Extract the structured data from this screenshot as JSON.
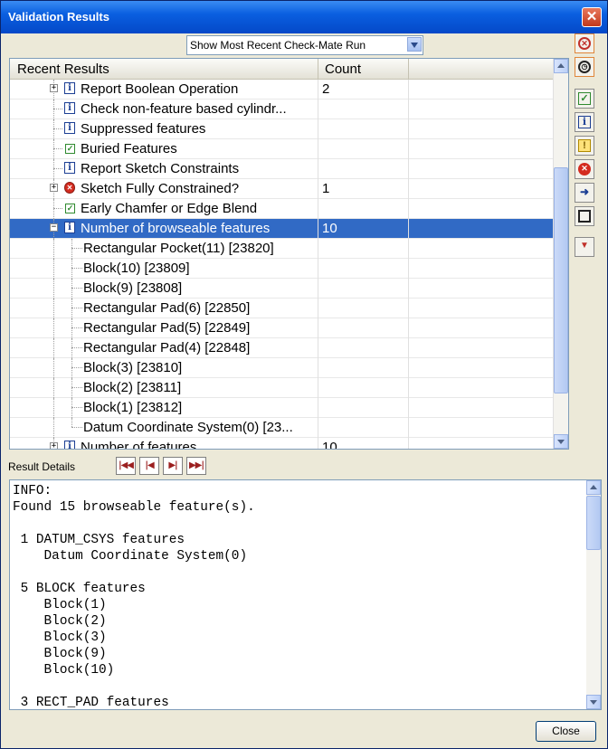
{
  "window": {
    "title": "Validation Results",
    "close_glyph": "✕"
  },
  "run_select": {
    "value": "Show Most Recent Check-Mate Run"
  },
  "results": {
    "headers": {
      "name": "Recent Results",
      "count": "Count"
    },
    "rows": [
      {
        "label": "Report Boolean Operation",
        "count": "2",
        "icon": "info-icon",
        "expander": "+",
        "indent": 1
      },
      {
        "label": "Check non-feature based cylindr...",
        "count": "",
        "icon": "info-icon",
        "expander": "",
        "indent": 1
      },
      {
        "label": "Suppressed features",
        "count": "",
        "icon": "info-icon",
        "expander": "",
        "indent": 1
      },
      {
        "label": "Buried Features",
        "count": "",
        "icon": "check-icon",
        "expander": "",
        "indent": 1
      },
      {
        "label": "Report Sketch Constraints",
        "count": "",
        "icon": "info-icon",
        "expander": "",
        "indent": 1
      },
      {
        "label": "Sketch Fully Constrained?",
        "count": "1",
        "icon": "error-icon",
        "expander": "+",
        "indent": 1
      },
      {
        "label": "Early Chamfer or Edge Blend",
        "count": "",
        "icon": "check-icon",
        "expander": "",
        "indent": 1
      },
      {
        "label": "Number of browseable features",
        "count": "10",
        "icon": "info-icon",
        "expander": "−",
        "indent": 1,
        "selected": true
      },
      {
        "label": "Rectangular Pocket(11) [23820]",
        "count": "",
        "icon": "",
        "expander": "",
        "indent": 2
      },
      {
        "label": "Block(10) [23809]",
        "count": "",
        "icon": "",
        "expander": "",
        "indent": 2
      },
      {
        "label": "Block(9) [23808]",
        "count": "",
        "icon": "",
        "expander": "",
        "indent": 2
      },
      {
        "label": "Rectangular Pad(6) [22850]",
        "count": "",
        "icon": "",
        "expander": "",
        "indent": 2
      },
      {
        "label": "Rectangular Pad(5) [22849]",
        "count": "",
        "icon": "",
        "expander": "",
        "indent": 2
      },
      {
        "label": "Rectangular Pad(4) [22848]",
        "count": "",
        "icon": "",
        "expander": "",
        "indent": 2
      },
      {
        "label": "Block(3) [23810]",
        "count": "",
        "icon": "",
        "expander": "",
        "indent": 2
      },
      {
        "label": "Block(2) [23811]",
        "count": "",
        "icon": "",
        "expander": "",
        "indent": 2
      },
      {
        "label": "Block(1) [23812]",
        "count": "",
        "icon": "",
        "expander": "",
        "indent": 2
      },
      {
        "label": "Datum Coordinate System(0) [23...",
        "count": "",
        "icon": "",
        "expander": "",
        "indent": 2
      },
      {
        "label": "Number of features",
        "count": "10",
        "icon": "info-icon",
        "expander": "+",
        "indent": 1
      }
    ]
  },
  "toolbar": [
    "delete-results-icon",
    "history-icon",
    "passed-filter-icon",
    "info-filter-icon",
    "warning-filter-icon",
    "error-filter-icon",
    "export-icon",
    "stop-icon",
    "filter-icon"
  ],
  "details": {
    "label": "Result Details",
    "nav": {
      "first": "|◀◀",
      "prev": "|◀",
      "next": "▶|",
      "last": "▶▶|"
    },
    "text": "INFO:\nFound 15 browseable feature(s).\n\n 1 DATUM_CSYS features\n    Datum Coordinate System(0)\n\n 5 BLOCK features\n    Block(1)\n    Block(2)\n    Block(3)\n    Block(9)\n    Block(10)\n\n 3 RECT_PAD features"
  },
  "close_button": {
    "label": "Close"
  }
}
